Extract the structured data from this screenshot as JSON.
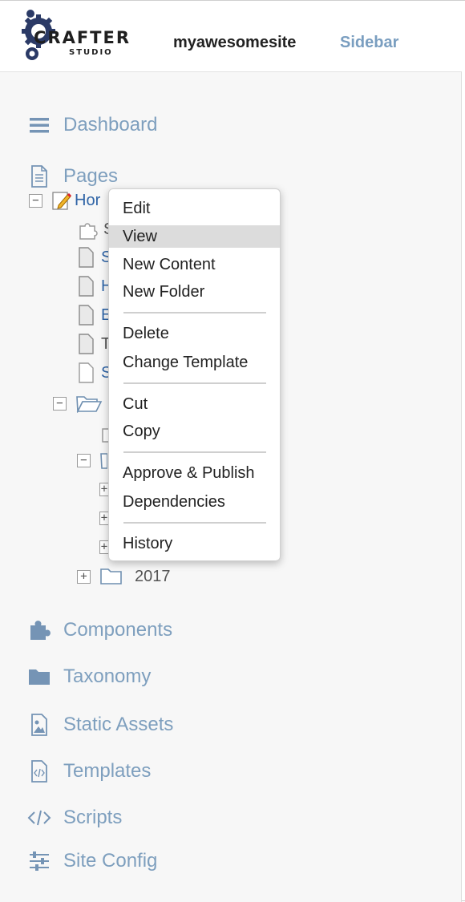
{
  "header": {
    "logo_text": "CRAFTER",
    "logo_subtext": "STUDIO",
    "site_name": "myawesomesite",
    "sidebar_label": "Sidebar"
  },
  "nav": {
    "dashboard": "Dashboard",
    "pages": "Pages",
    "components": "Components",
    "taxonomy": "Taxonomy",
    "static_assets": "Static Assets",
    "templates": "Templates",
    "scripts": "Scripts",
    "site_config": "Site Config"
  },
  "tree": {
    "home_partial": "Hor",
    "row_partials": [
      "S",
      "S",
      "H",
      "E",
      "T",
      "S"
    ],
    "year_folder": "2017"
  },
  "context_menu": {
    "items": [
      "Edit",
      "View",
      "New Content",
      "New Folder",
      "Delete",
      "Change Template",
      "Cut",
      "Copy",
      "Approve & Publish",
      "Dependencies",
      "History"
    ],
    "hovered": "View"
  },
  "colors": {
    "nav_text": "#7e9fbe",
    "nav_icon": "#7594b5",
    "link_text": "#2f64a6"
  }
}
